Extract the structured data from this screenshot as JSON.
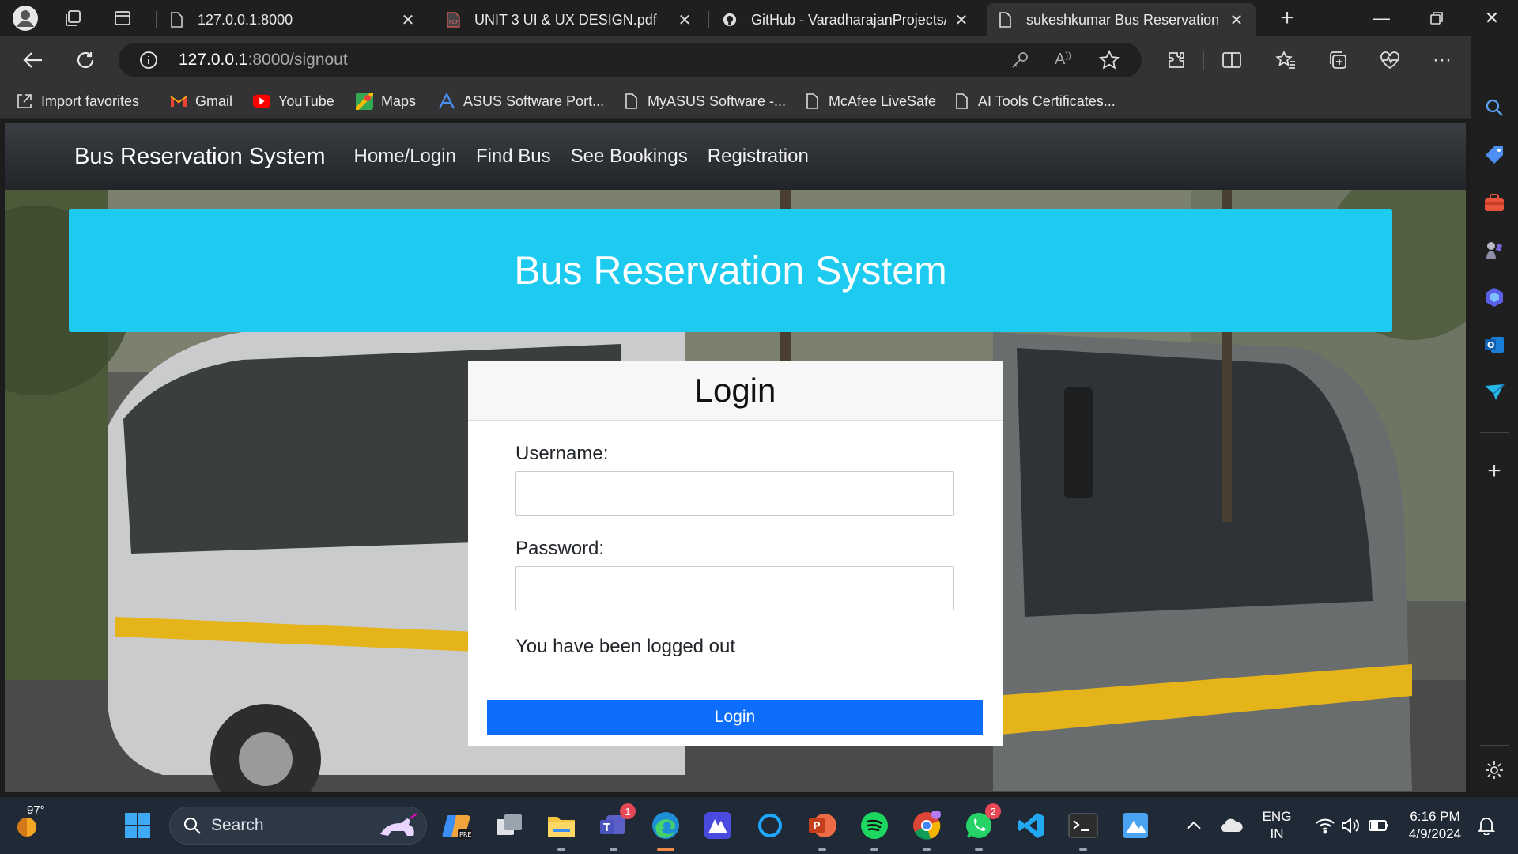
{
  "browser": {
    "tabs": [
      {
        "title": "127.0.0.1:8000",
        "active": false
      },
      {
        "title": "UNIT 3 UI & UX DESIGN.pdf",
        "active": false
      },
      {
        "title": "GitHub - VaradharajanProjects/I",
        "active": false
      },
      {
        "title": "sukeshkumar Bus Reservation Sy",
        "active": true
      }
    ],
    "address": {
      "host": "127.0.0.1",
      "path": ":8000/signout"
    },
    "favorites": [
      "Import favorites",
      "Gmail",
      "YouTube",
      "Maps",
      "ASUS Software Port...",
      "MyASUS Software -...",
      "McAfee LiveSafe",
      "AI Tools Certificates..."
    ]
  },
  "page": {
    "brand": "Bus Reservation System",
    "nav": [
      "Home/Login",
      "Find Bus",
      "See Bookings",
      "Registration"
    ],
    "hero_title": "Bus Reservation System",
    "login": {
      "title": "Login",
      "username_label": "Username:",
      "username_value": "",
      "password_label": "Password:",
      "password_value": "",
      "message": "You have been logged out",
      "button": "Login"
    }
  },
  "taskbar": {
    "weather": "97°",
    "search_placeholder": "Search",
    "teams_badge": "1",
    "whatsapp_badge": "2",
    "lang": "ENG",
    "region": "IN",
    "time": "6:16 PM",
    "date": "4/9/2024"
  },
  "colors": {
    "accent": "#1ccbef",
    "button": "#0d6efd",
    "navbar": "#212529"
  }
}
